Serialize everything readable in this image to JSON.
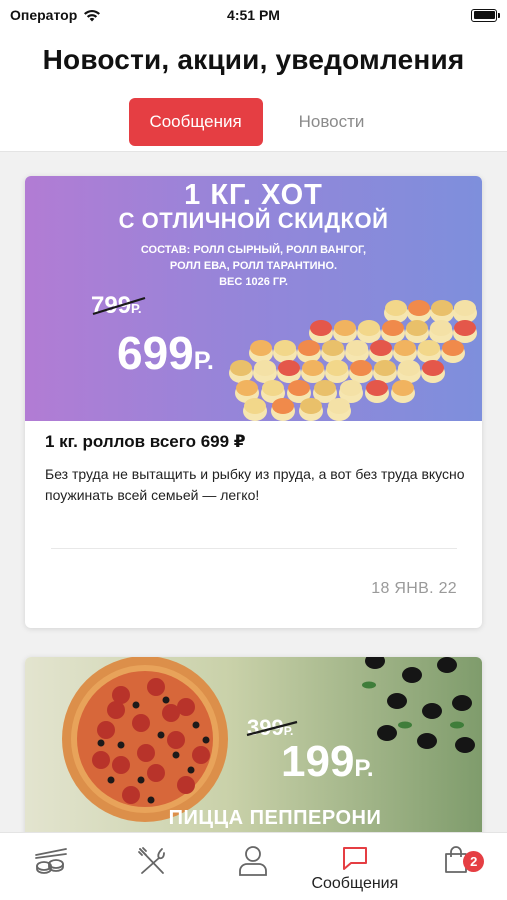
{
  "status_bar": {
    "carrier": "Оператор",
    "time": "4:51 PM",
    "battery_level": 1.0
  },
  "header": {
    "title": "Новости, акции, уведомления",
    "tabs": [
      {
        "label": "Сообщения",
        "active": true
      },
      {
        "label": "Новости",
        "active": false
      }
    ]
  },
  "colors": {
    "accent": "#e53e43",
    "inactive_tab": "#8b8b8b",
    "date": "#9a9a9a"
  },
  "feed": {
    "cards": [
      {
        "banner": {
          "headline": "1 кг. хот",
          "subheadline": "с отличной скидкой",
          "composition_1": "Состав: ролл сырный, ролл вангог,",
          "composition_2": "ролл ева, ролл тарантино.",
          "composition_3": "Вес 1026 гр.",
          "old_price": "799",
          "old_currency": "Р.",
          "new_price": "699",
          "new_currency": "Р."
        },
        "title": "1 кг. роллов всего 699 ₽",
        "description": "Без труда не вытащить и рыбку из пруда, а вот без труда вкусно поужинать всей семьей — легко!",
        "date": "18 ЯНВ. 22"
      },
      {
        "banner": {
          "old_price": "399",
          "old_currency": "Р.",
          "new_price": "199",
          "new_currency": "Р.",
          "product_name": "Пицца пепперони"
        }
      }
    ]
  },
  "tab_bar": {
    "items": [
      {
        "icon": "sushi-icon",
        "label": ""
      },
      {
        "icon": "fork-knife-icon",
        "label": ""
      },
      {
        "icon": "profile-icon",
        "label": ""
      },
      {
        "icon": "message-icon",
        "label": "Сообщения",
        "active": true
      },
      {
        "icon": "cart-bag-icon",
        "label": "",
        "badge": "2"
      }
    ]
  }
}
